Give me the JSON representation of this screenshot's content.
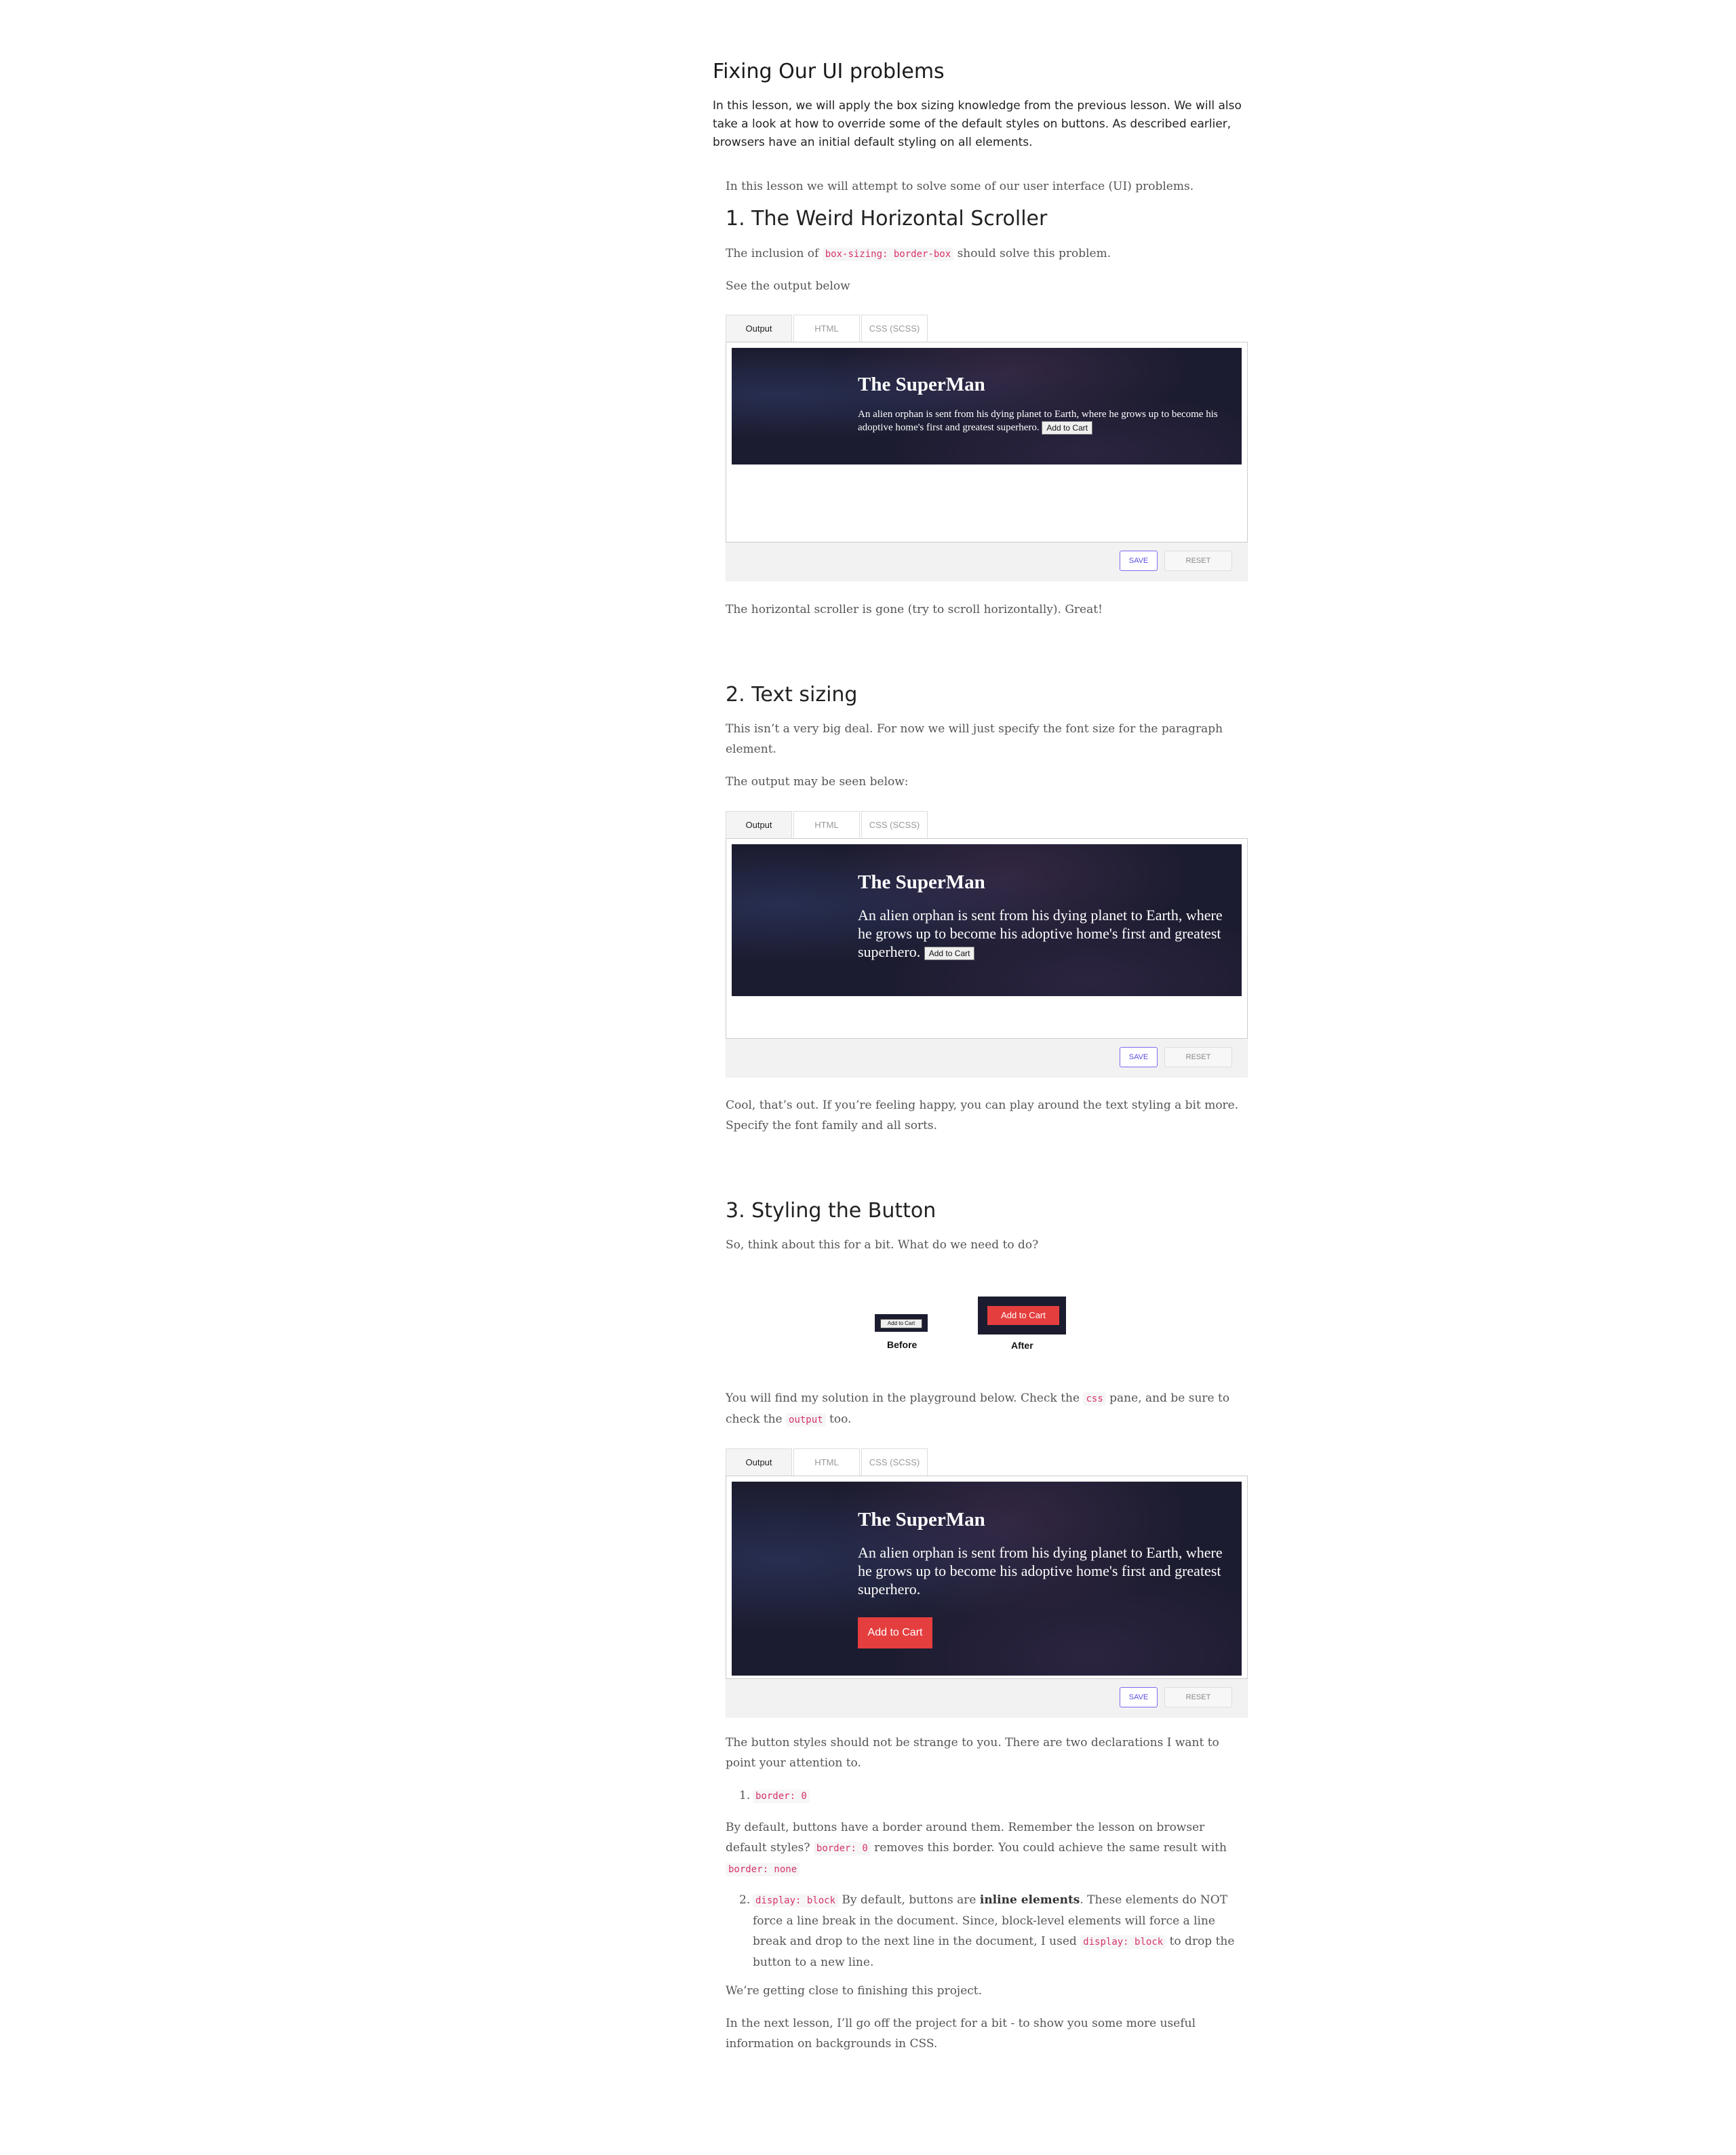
{
  "page": {
    "title": "Fixing Our UI problems",
    "intro": "In this lesson, we will apply the box sizing knowledge from the previous lesson. We will also take a look at how to override some of the default styles on buttons. As described earlier, browsers have an initial default styling on all elements."
  },
  "lead": "In this lesson we will attempt to solve some of our user interface (UI) problems.",
  "section1": {
    "heading": "1. The Weird Horizontal Scroller",
    "p1_before": "The inclusion of ",
    "p1_code": "box-sizing: border-box",
    "p1_after": " should solve this problem.",
    "p2": "See the output below",
    "after": "The horizontal scroller is gone (try to scroll horizontally). Great!"
  },
  "section2": {
    "heading": "2. Text sizing",
    "p1": "This isn’t a very big deal. For now we will just specify the font size for the paragraph element.",
    "p2": "The output may be seen below:",
    "after": "Cool, that’s out. If you’re feeling happy, you can play around the text styling a bit more. Specify the font family and all sorts."
  },
  "section3": {
    "heading": "3. Styling the Button",
    "p1": "So, think about this for a bit. What do we need to do?",
    "figure": {
      "before_label": "Before",
      "after_label": "After",
      "before_button": "Add to Cart",
      "after_button": "Add to Cart"
    },
    "p2_a": "You will find my solution in the playground below. Check the ",
    "p2_code1": "css",
    "p2_b": " pane, and be sure to check the ",
    "p2_code2": "output",
    "p2_c": " too.",
    "p3": "The button styles should not be strange to you. There are two declarations I want to point your attention to.",
    "li1_num": "1.",
    "li1_code": "border: 0",
    "p4_a": "By default, buttons have a border around them. Remember the lesson on browser default styles? ",
    "p4_code1": "border: 0",
    "p4_b": " removes this border. You could achieve the same result with ",
    "p4_code2": "border: none",
    "li2_num": "2.",
    "li2_code": "display: block",
    "li2_a": " By default, buttons are ",
    "li2_bold": "inline elements",
    "li2_b": ". These elements do NOT force a line break in the document. Since, block-level elements will force a line break and drop to the next line in the document, I used ",
    "li2_code2": "display: block",
    "li2_c": " to drop the button to a new line.",
    "p5": "We’re getting close to finishing this project.",
    "p6": "In the next lesson, I’ll go off the project for a bit - to show you some more useful information on backgrounds in CSS."
  },
  "playground": {
    "tabs": [
      "Output",
      "HTML",
      "CSS (SCSS)"
    ],
    "save": "SAVE",
    "reset": "RESET",
    "hero_title": "The SuperMan",
    "hero_text": "An alien orphan is sent from his dying planet to Earth, where he grows up to become his adoptive home's first and greatest superhero.",
    "button": "Add to Cart"
  },
  "colors": {
    "hero_bg": "#1c1c30",
    "red_button": "#e53e3e",
    "code_text": "#d6336c",
    "save_accent": "#5a4ee0"
  }
}
